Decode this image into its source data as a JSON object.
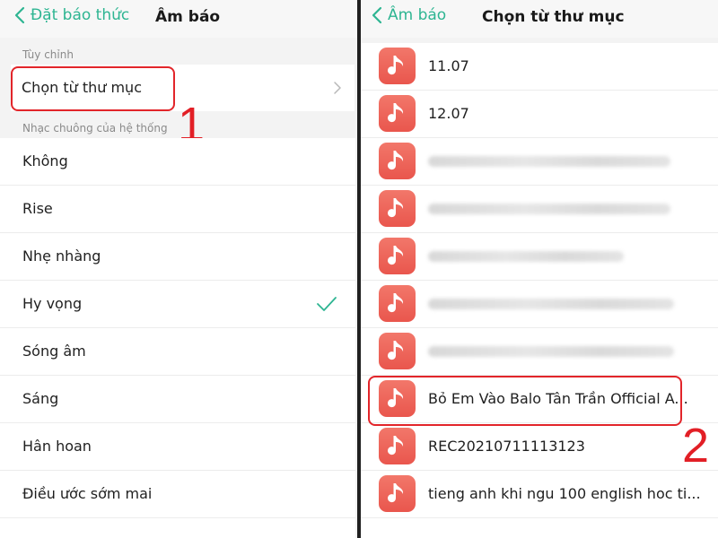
{
  "left": {
    "back_label": "Đặt báo thức",
    "title": "Âm báo",
    "custom_section": "Tùy chỉnh",
    "choose_folder": "Chọn từ thư mục",
    "system_section": "Nhạc chuông của hệ thống",
    "ringtones": [
      {
        "label": "Không"
      },
      {
        "label": "Rise"
      },
      {
        "label": "Nhẹ nhàng"
      },
      {
        "label": "Hy vọng"
      },
      {
        "label": "Sóng âm"
      },
      {
        "label": "Sáng"
      },
      {
        "label": "Hân hoan"
      },
      {
        "label": "Điều ước sớm mai"
      }
    ],
    "selected_ringtone": "Hy vọng",
    "step_number": "1"
  },
  "right": {
    "back_label": "Âm báo",
    "title": "Chọn từ thư mục",
    "songs": [
      {
        "label": "11.07"
      },
      {
        "label": "12.07"
      },
      {
        "label": ""
      },
      {
        "label": ""
      },
      {
        "label": ""
      },
      {
        "label": ""
      },
      {
        "label": ""
      },
      {
        "label": "Bỏ Em Vào Balo  Tân Trần  Official A..."
      },
      {
        "label": "REC20210711113123"
      },
      {
        "label": "tieng anh khi ngu 100 english hoc ti..."
      }
    ],
    "step_number": "2"
  },
  "colors": {
    "accent": "#2eb592",
    "highlight": "#e2252a",
    "icon": "#ec5f55"
  }
}
